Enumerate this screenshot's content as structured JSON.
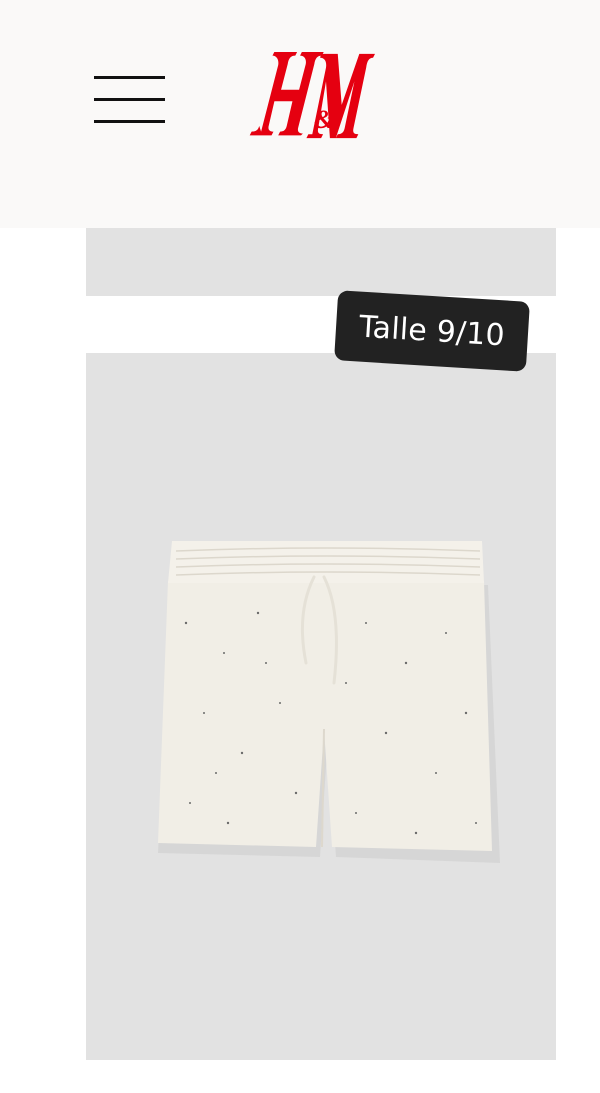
{
  "header": {
    "brand": "H&M",
    "brand_color": "#e50010",
    "menu_icon": "hamburger-menu-icon"
  },
  "product": {
    "image_description_icon": "shorts-product-image",
    "size_badge": "Talle 9/10"
  }
}
